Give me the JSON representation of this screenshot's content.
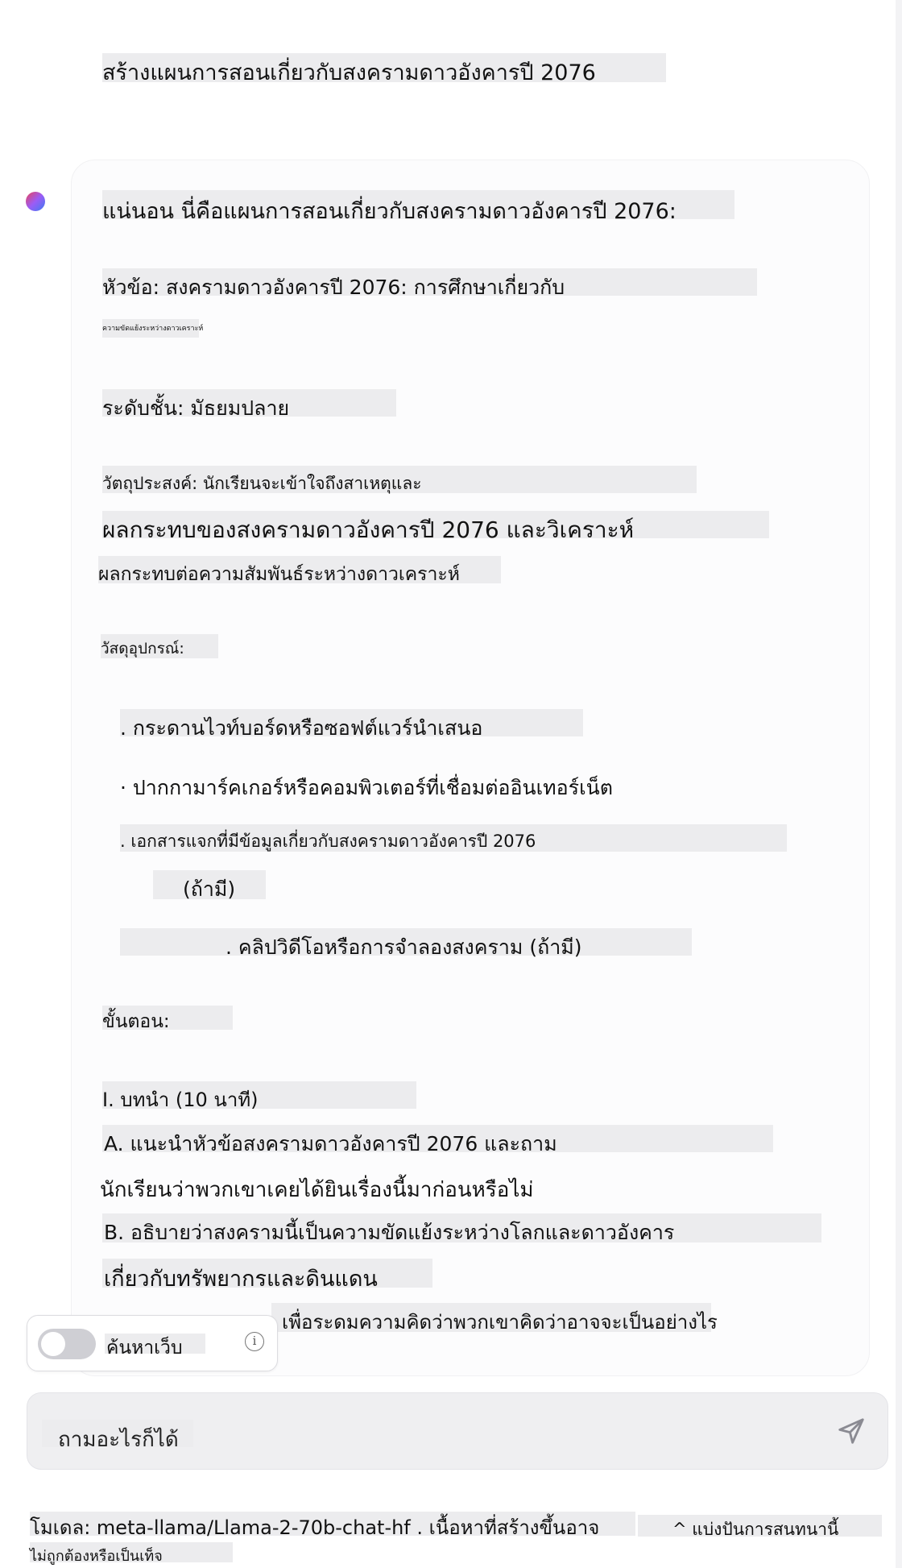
{
  "user_message": "สร้างแผนการสอนเกี่ยวกับสงครามดาวอังคารปี 2076",
  "assistant": {
    "intro": "แน่นอน นี่คือแผนการสอนเกี่ยวกับสงครามดาวอังคารปี 2076:",
    "topic_line1": "หัวข้อ: สงครามดาวอังคารปี 2076: การศึกษาเกี่ยวกับ",
    "topic_line2": "ความขัดแย้งระหว่างดาวเคราะห์",
    "level": "ระดับชั้น: มัธยมปลาย",
    "objective_line1": "วัตถุประสงค์: นักเรียนจะเข้าใจถึงสาเหตุและ",
    "objective_line2": "ผลกระทบของสงครามดาวอังคารปี 2076 และวิเคราะห์",
    "objective_line3": "ผลกระทบต่อความสัมพันธ์ระหว่างดาวเคราะห์",
    "materials_heading": "วัสดุอุปกรณ์:",
    "material_1": ". กระดานไวท์บอร์ดหรือซอฟต์แวร์นำเสนอ",
    "material_2": "· ปากกามาร์คเกอร์หรือคอมพิวเตอร์ที่เชื่อมต่ออินเทอร์เน็ต",
    "material_3": ". เอกสารแจกที่มีข้อมูลเกี่ยวกับสงครามดาวอังคารปี 2076",
    "material_3_cont": "(ถ้ามี)",
    "material_4": ". คลิปวิดีโอหรือการจำลองสงคราม (ถ้ามี)",
    "steps_heading": "ขั้นตอน:",
    "step_1": "I. บทนำ (10 นาที)",
    "step_1a_line1": "A. แนะนำหัวข้อสงครามดาวอังคารปี 2076 และถาม",
    "step_1a_line2": "นักเรียนว่าพวกเขาเคยได้ยินเรื่องนี้มาก่อนหรือไม่",
    "step_1b_line1": "B. อธิบายว่าสงครามนี้เป็นความขัดแย้งระหว่างโลกและดาวอังคาร",
    "step_1b_line2": "เกี่ยวกับทรัพยากรและดินแดน",
    "step_1c_partial": "เพื่อระดมความคิดว่าพวกเขาคิดว่าอาจจะเป็นอย่างไร"
  },
  "web_search": {
    "label": "ค้นหาเว็บ",
    "enabled": false
  },
  "composer": {
    "placeholder": "ถามอะไรก็ได้"
  },
  "footer": {
    "model_line1": "โมเดล: meta-llama/Llama-2-70b-chat-hf . เนื้อหาที่สร้างขึ้นอาจ",
    "model_line2": "ไม่ถูกต้องหรือเป็นเท็จ",
    "share": "^ แบ่งปันการสนทนานี้"
  },
  "colors": {
    "avatar_gradient": [
      "#e9445a",
      "#9b5cf6",
      "#3d7bf0"
    ],
    "highlight": "#ececee",
    "composer_bg": "#efeff1",
    "toggle_off": "#cfcfd4"
  }
}
